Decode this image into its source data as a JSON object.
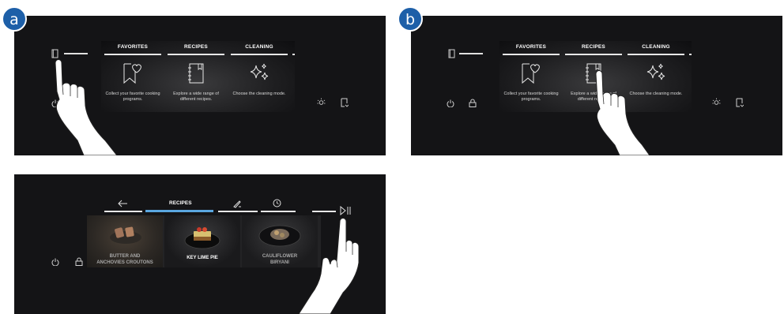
{
  "badges": {
    "a": "a",
    "b": "b"
  },
  "oven_menu": {
    "tabs": [
      "FAVORITES",
      "RECIPES",
      "CLEANING"
    ],
    "cards": [
      {
        "icon": "bookmark-heart-icon",
        "text": "Collect your favorite cooking programs."
      },
      {
        "icon": "recipe-book-icon",
        "text": "Explore a wide range of different recipes."
      },
      {
        "icon": "sparkle-icon",
        "text": "Choose the cleaning mode."
      }
    ]
  },
  "recipes_screen": {
    "tab_label": "RECIPES",
    "items": [
      {
        "label_line1": "BUTTER AND",
        "label_line2": "ANCHOVIES CROUTONS",
        "selected": false
      },
      {
        "label_line1": "KEY LIME PIE",
        "label_line2": "",
        "selected": true
      },
      {
        "label_line1": "CAULIFLOWER",
        "label_line2": "BIRYANI",
        "selected": false
      }
    ]
  },
  "colors": {
    "badge": "#1d5fa8",
    "panel": "#141416",
    "accent_tab": "#5aa7e0"
  }
}
